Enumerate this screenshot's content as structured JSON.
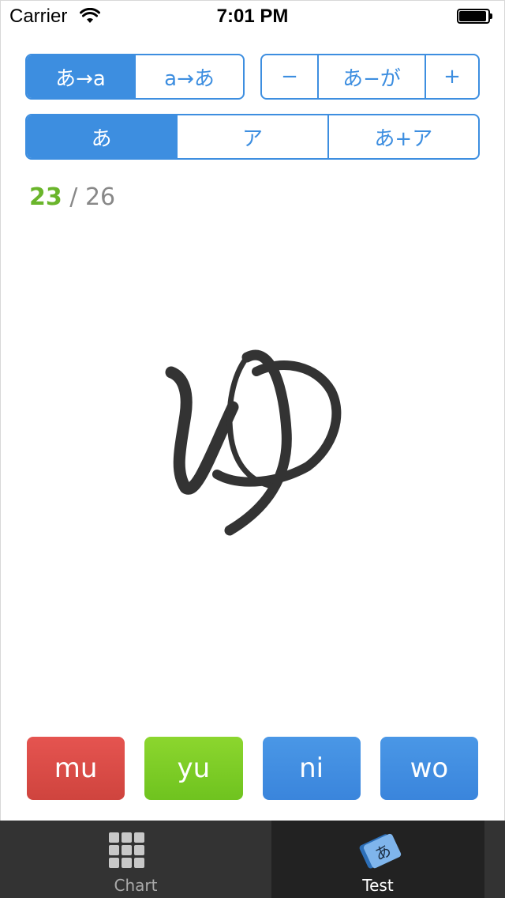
{
  "status_bar": {
    "carrier": "Carrier",
    "time": "7:01 PM"
  },
  "direction_control": {
    "options": [
      "あ→a",
      "a→あ"
    ],
    "selected_index": 0
  },
  "range_control": {
    "minus_label": "−",
    "range_label": "あ−が",
    "plus_label": "+"
  },
  "script_control": {
    "options": [
      "あ",
      "ア",
      "あ+ア"
    ],
    "selected_index": 0
  },
  "score": {
    "correct": "23",
    "separator": "/",
    "total": "26"
  },
  "question": {
    "kana": "ゆ"
  },
  "answers": [
    {
      "label": "mu",
      "color": "#df4b44"
    },
    {
      "label": "yu",
      "color": "#7fcc27"
    },
    {
      "label": "ni",
      "color": "#3d8ee0"
    },
    {
      "label": "wo",
      "color": "#3d8ee0"
    }
  ],
  "tab_bar": {
    "tabs": [
      {
        "label": "Chart",
        "icon": "grid-icon"
      },
      {
        "label": "Test",
        "icon": "flashcard-icon",
        "selected": true
      }
    ],
    "card_glyph": "あ"
  },
  "colors": {
    "accent": "#3d8ee0",
    "correct": "#6ab52b",
    "wrong": "#df4b44"
  }
}
